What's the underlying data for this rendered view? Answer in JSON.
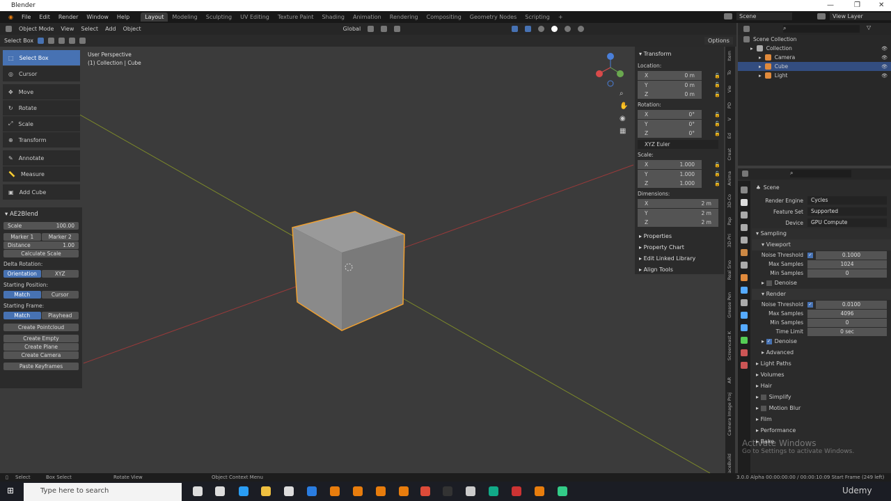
{
  "title": "Blender",
  "menu": [
    "File",
    "Edit",
    "Render",
    "Window",
    "Help"
  ],
  "workspaces": [
    "Layout",
    "Modeling",
    "Sculpting",
    "UV Editing",
    "Texture Paint",
    "Shading",
    "Animation",
    "Rendering",
    "Compositing",
    "Geometry Nodes",
    "Scripting",
    "+"
  ],
  "scene": "Scene",
  "view_layer": "View Layer",
  "vphead": {
    "mode": "Object Mode",
    "menus": [
      "View",
      "Select",
      "Add",
      "Object"
    ],
    "orientation": "Global",
    "options": "Options"
  },
  "toolset": {
    "label": "Select Box"
  },
  "overlay": {
    "perspective": "User Perspective",
    "collection": "(1) Collection | Cube"
  },
  "tools": [
    {
      "label": "Select Box"
    },
    {
      "label": "Cursor"
    },
    {
      "label": "Move"
    },
    {
      "label": "Rotate"
    },
    {
      "label": "Scale"
    },
    {
      "label": "Transform"
    },
    {
      "label": "Annotate"
    },
    {
      "label": "Measure"
    },
    {
      "label": "Add Cube"
    }
  ],
  "ae2": {
    "title": "AE2Blend",
    "scale_label": "Scale",
    "scale": "100.00",
    "marker1": "Marker 1",
    "marker2": "Marker 2",
    "distance_label": "Distance",
    "distance": "1.00",
    "calc": "Calculate Scale",
    "delta": "Delta Rotation:",
    "orientation": "Orientation",
    "xyz": "XYZ",
    "startpos": "Starting Position:",
    "match": "Match",
    "cursor": "Cursor",
    "startframe": "Starting Frame:",
    "playhead": "Playhead",
    "pointcloud": "Create Pointcloud",
    "empty": "Create Empty",
    "plane": "Create Plane",
    "camera": "Create Camera",
    "paste": "Paste Keyframes"
  },
  "transform": {
    "title": "Transform",
    "location": "Location:",
    "rotation": "Rotation:",
    "scale": "Scale:",
    "dimensions": "Dimensions:",
    "euler": "XYZ Euler",
    "loc": [
      [
        "X",
        "0 m"
      ],
      [
        "Y",
        "0 m"
      ],
      [
        "Z",
        "0 m"
      ]
    ],
    "rot": [
      [
        "X",
        "0°"
      ],
      [
        "Y",
        "0°"
      ],
      [
        "Z",
        "0°"
      ]
    ],
    "scl": [
      [
        "X",
        "1.000"
      ],
      [
        "Y",
        "1.000"
      ],
      [
        "Z",
        "1.000"
      ]
    ],
    "dim": [
      [
        "X",
        "2 m"
      ],
      [
        "Y",
        "2 m"
      ],
      [
        "Z",
        "2 m"
      ]
    ],
    "subpanels": [
      "Properties",
      "Property Chart",
      "Edit Linked Library",
      "Align Tools"
    ]
  },
  "ntabs": [
    "Item",
    "To",
    "Vie",
    "PD",
    "V",
    "Ed",
    "Creat",
    "Anima",
    "3D-Co",
    "Pap",
    "3D-Pri",
    "Real Sno",
    "Grease Pen",
    "Screencast K",
    "AR",
    "Camera Image Proj",
    "FaceBuild"
  ],
  "outliner": {
    "root": "Scene Collection",
    "items": [
      {
        "label": "Collection",
        "color": "#aaaaaa"
      },
      {
        "label": "Camera",
        "color": "#e08a3c"
      },
      {
        "label": "Cube",
        "color": "#e08a3c"
      },
      {
        "label": "Light",
        "color": "#e08a3c"
      }
    ]
  },
  "props": {
    "context": "Scene",
    "render_engine_label": "Render Engine",
    "render_engine": "Cycles",
    "feature_set_label": "Feature Set",
    "feature_set": "Supported",
    "device_label": "Device",
    "device": "GPU Compute",
    "sampling": "Sampling",
    "viewport": "Viewport",
    "noise": "Noise Threshold",
    "vp_noise": "0.1000",
    "max": "Max Samples",
    "vp_max": "1024",
    "min": "Min Samples",
    "vp_min": "0",
    "denoise": "Denoise",
    "render": "Render",
    "r_noise": "0.0100",
    "r_max": "4096",
    "r_min": "0",
    "time": "Time Limit",
    "r_time": "0 sec",
    "advanced": "Advanced",
    "sections": [
      "Light Paths",
      "Volumes",
      "Hair",
      "Simplify",
      "Motion Blur",
      "Film",
      "Performance",
      "Bake"
    ]
  },
  "status": {
    "select": "Select",
    "box": "Box Select",
    "rotate": "Rotate View",
    "context": "Object Context Menu",
    "right": "3.0.0 Alpha  00:00:00:00 / 00:00:10:09  Start Frame (249 left)"
  },
  "taskbar": {
    "search": "Type here to search",
    "brand": "Udemy"
  },
  "watermark": {
    "title": "Activate Windows",
    "sub": "Go to Settings to activate Windows."
  }
}
